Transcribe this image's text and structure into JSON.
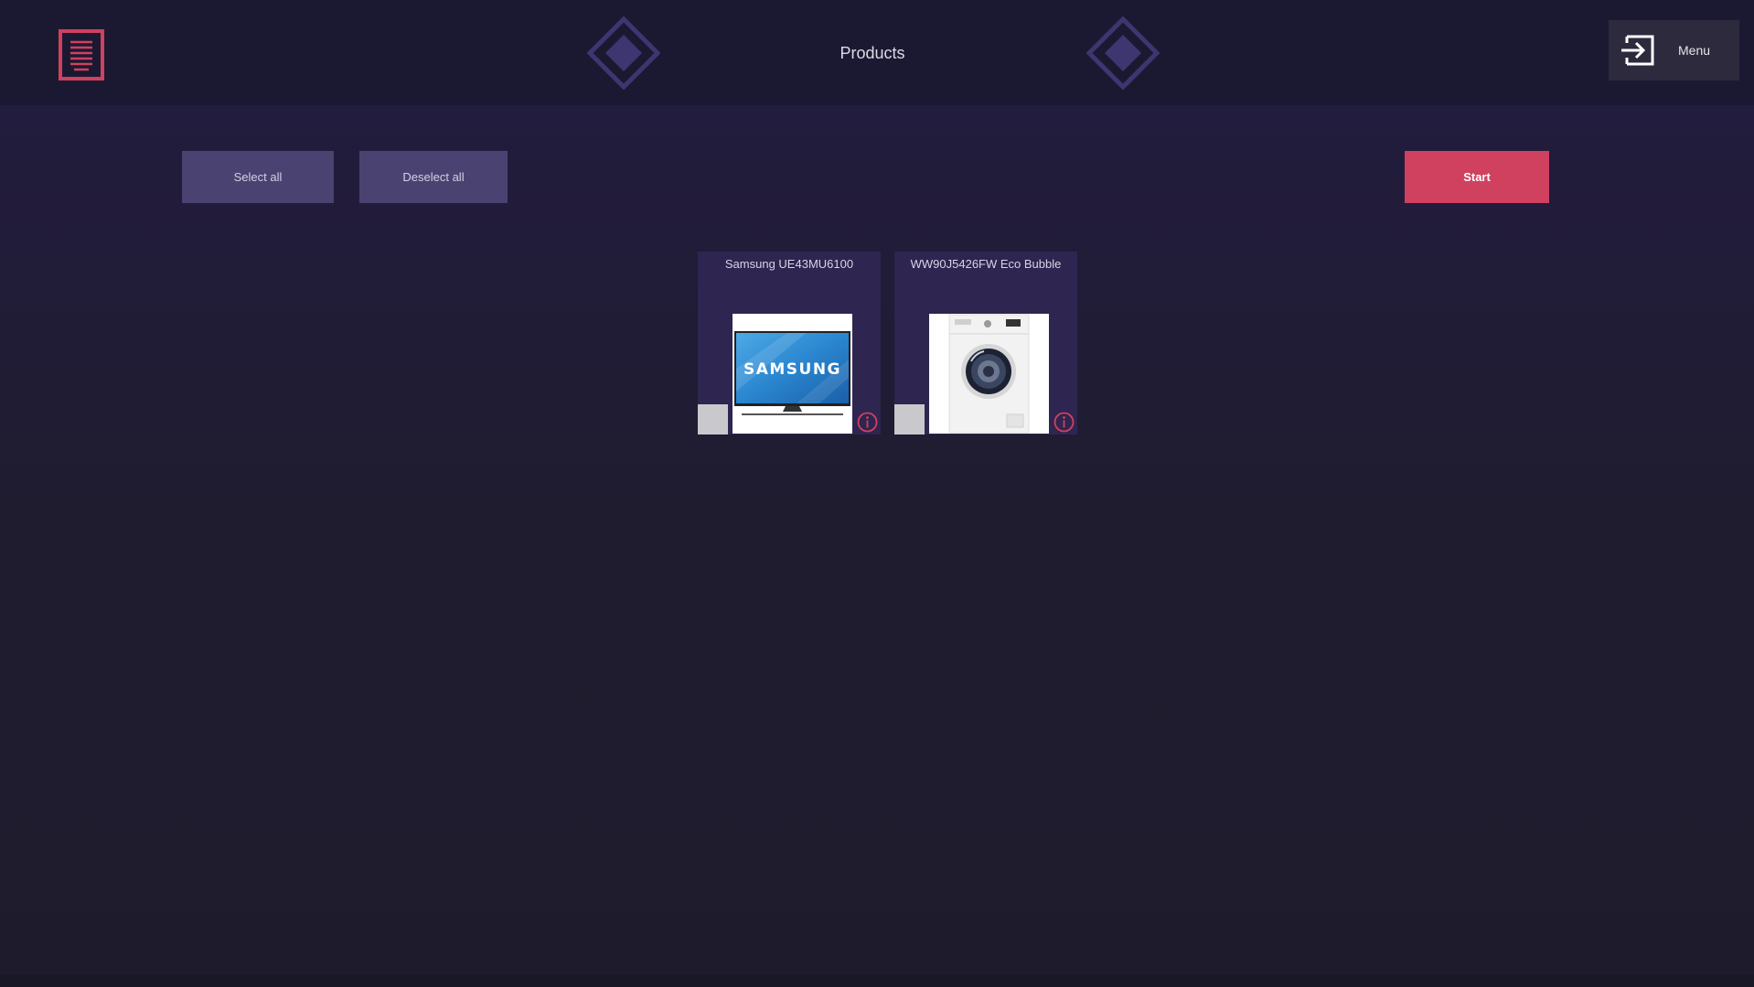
{
  "header": {
    "title": "Products",
    "app_icon": "document-list-icon",
    "menu_label": "Menu",
    "menu_icon": "sign-in-arrow-icon"
  },
  "toolbar": {
    "select_all_label": "Select all",
    "deselect_all_label": "Deselect all",
    "start_label": "Start"
  },
  "products": [
    {
      "name": "Samsung UE43MU6100",
      "image_icon": "tv-icon",
      "image_text": "SAMSUNG",
      "selected": false,
      "info_icon": "info-icon"
    },
    {
      "name": "WW90J5426FW Eco Bubble",
      "image_icon": "washing-machine-icon",
      "selected": false,
      "info_icon": "info-icon"
    }
  ],
  "colors": {
    "accent": "#d0415f",
    "background": "#1e1c2c",
    "topbar": "#1b1932",
    "button": "#4a4372",
    "card": "#2e2550",
    "diamond": "#3e3670"
  }
}
